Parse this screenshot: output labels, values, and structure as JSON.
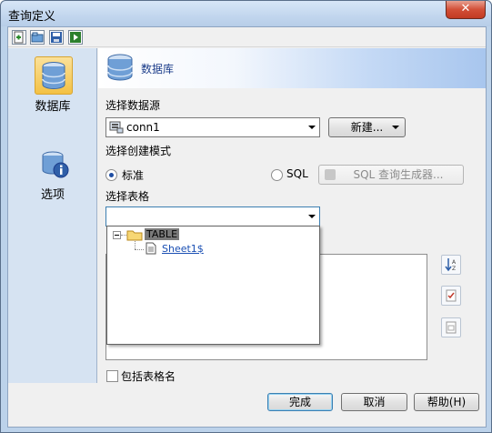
{
  "window": {
    "title": "查询定义",
    "close_glyph": "✕"
  },
  "toolbar": {
    "icons": [
      "new-query-icon",
      "open-icon",
      "save-icon",
      "run-icon"
    ]
  },
  "sidebar": {
    "items": [
      {
        "label": "数据库",
        "icon": "database-icon",
        "active": true
      },
      {
        "label": "选项",
        "icon": "database-info-icon",
        "active": false
      }
    ]
  },
  "main": {
    "header_title": "数据库",
    "datasource_label": "选择数据源",
    "datasource_value": "conn1",
    "new_button_label": "新建...",
    "mode_label": "选择创建模式",
    "mode_standard_label": "标准",
    "mode_sql_label": "SQL",
    "sql_builder_label": "SQL 查询生成器...",
    "table_label": "选择表格",
    "table_value": "",
    "tree": {
      "root_label": "TABLE",
      "child_label": "Sheet1$"
    },
    "include_table_name_label": "包括表格名"
  },
  "footer": {
    "done_label": "完成",
    "cancel_label": "取消",
    "help_label": "帮助(H)"
  },
  "colors": {
    "accent": "#1c3d8a",
    "link": "#1a4fb3",
    "selected_node": "#7a7a7a"
  }
}
